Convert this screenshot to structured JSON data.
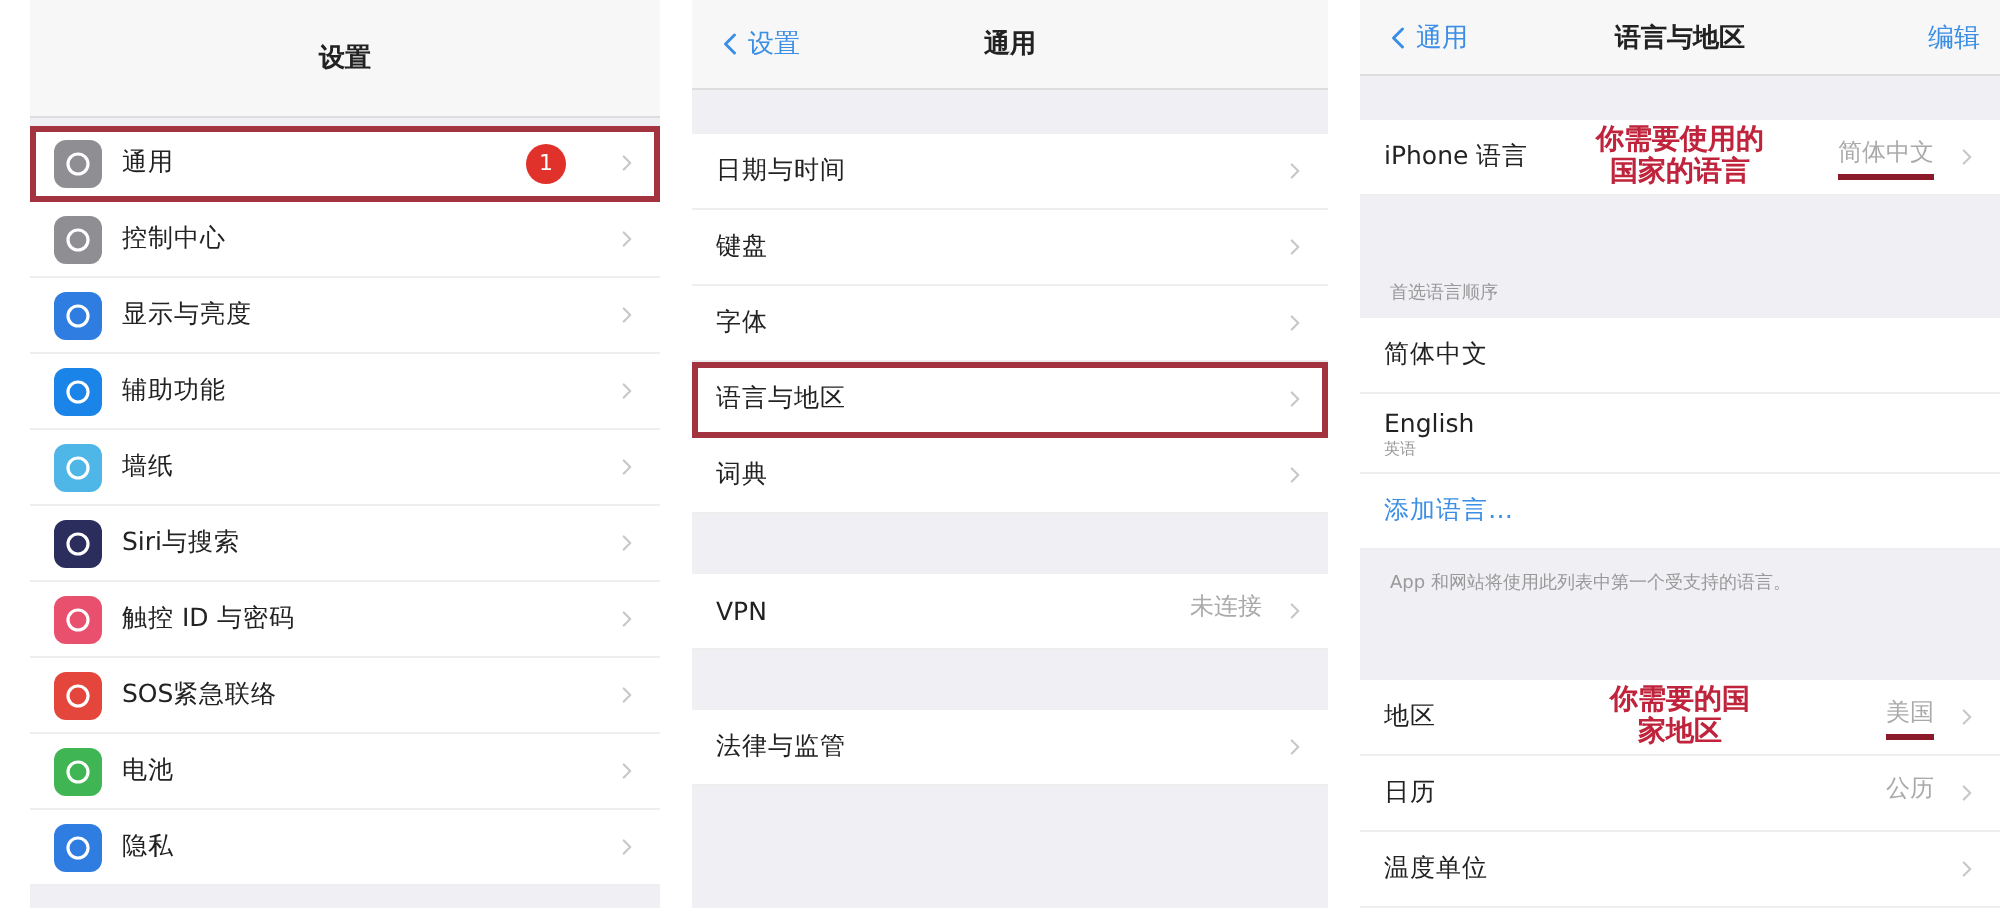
{
  "panels": [
    {
      "nav": {
        "title": "设置"
      },
      "sections": [
        {
          "rows": [
            {
              "label": "通用",
              "color": "#8e8e93",
              "badge": "1",
              "highlighted": true
            },
            {
              "label": "控制中心",
              "color": "#8e8e93",
              "highlighted": false
            },
            {
              "label": "显示与亮度",
              "color": "#2f7de1",
              "highlighted": false
            },
            {
              "label": "辅助功能",
              "color": "#1a84e8",
              "highlighted": false
            },
            {
              "label": "墙纸",
              "color": "#4fb6e8",
              "highlighted": false
            },
            {
              "label": "Siri与搜索",
              "color": "#2b2d5c",
              "highlighted": false
            },
            {
              "label": "触控 ID 与密码",
              "color": "#e8506e",
              "highlighted": false
            },
            {
              "label": "SOS紧急联络",
              "color": "#e5463c",
              "highlighted": false
            },
            {
              "label": "电池",
              "color": "#40b553",
              "highlighted": false
            },
            {
              "label": "隐私",
              "color": "#2f7de1",
              "highlighted": false
            }
          ]
        }
      ]
    },
    {
      "nav": {
        "back": "设置",
        "title": "通用"
      },
      "sections": [
        {
          "rows": [
            {
              "label": "日期与时间",
              "highlighted": false
            },
            {
              "label": "键盘",
              "highlighted": false
            },
            {
              "label": "字体",
              "highlighted": false
            },
            {
              "label": "语言与地区",
              "highlighted": true
            },
            {
              "label": "词典",
              "highlighted": false
            }
          ]
        },
        {
          "rows": [
            {
              "label": "VPN",
              "value": "未连接",
              "highlighted": false
            }
          ]
        },
        {
          "rows": [
            {
              "label": "法律与监管",
              "highlighted": false
            }
          ]
        }
      ]
    },
    {
      "nav": {
        "back": "通用",
        "title": "语言与地区",
        "action": "编辑"
      },
      "sections": [
        {
          "rows": [
            {
              "label": "iPhone 语言",
              "value": "简体中文",
              "annotation": [
                "你需要使用的",
                "国家的语言"
              ],
              "highlighted": false
            }
          ]
        },
        {
          "header": "首选语言顺序",
          "rows": [
            {
              "label": "简体中文",
              "highlighted": false
            },
            {
              "label": "English",
              "sublabel": "英语",
              "highlighted": false
            },
            {
              "label": "添加语言…",
              "kind": "link",
              "highlighted": false
            }
          ],
          "footer": "App 和网站将使用此列表中第一个受支持的语言。"
        },
        {
          "rows": [
            {
              "label": "地区",
              "value": "美国",
              "annotation": [
                "你需要的国",
                "家地区"
              ],
              "highlighted": false
            },
            {
              "label": "日历",
              "value": "公历",
              "highlighted": false
            },
            {
              "label": "温度单位",
              "highlighted": false
            }
          ]
        }
      ]
    }
  ]
}
